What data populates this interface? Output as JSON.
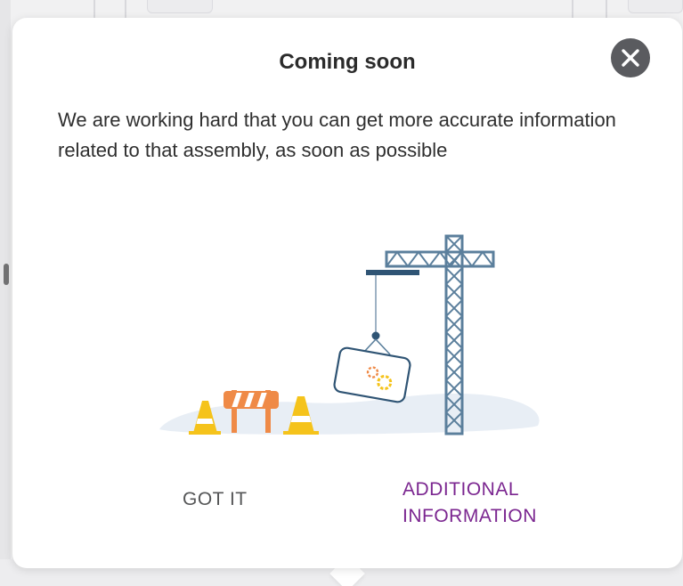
{
  "dialog": {
    "title": "Coming soon",
    "message": "We are working hard that you can get more accurate information related to that assembly, as soon as possible",
    "close_icon": "close-icon",
    "illustration_icon": "construction-crane-illustration"
  },
  "actions": {
    "got_it_label": "GOT IT",
    "additional_label": "ADDITIONAL INFORMATION"
  },
  "colors": {
    "accent": "#7b2690",
    "close_bg": "#5a5b5f",
    "crane": "#5b7f9c",
    "cone": "#f5c31b",
    "barrier": "#ef8a47"
  }
}
